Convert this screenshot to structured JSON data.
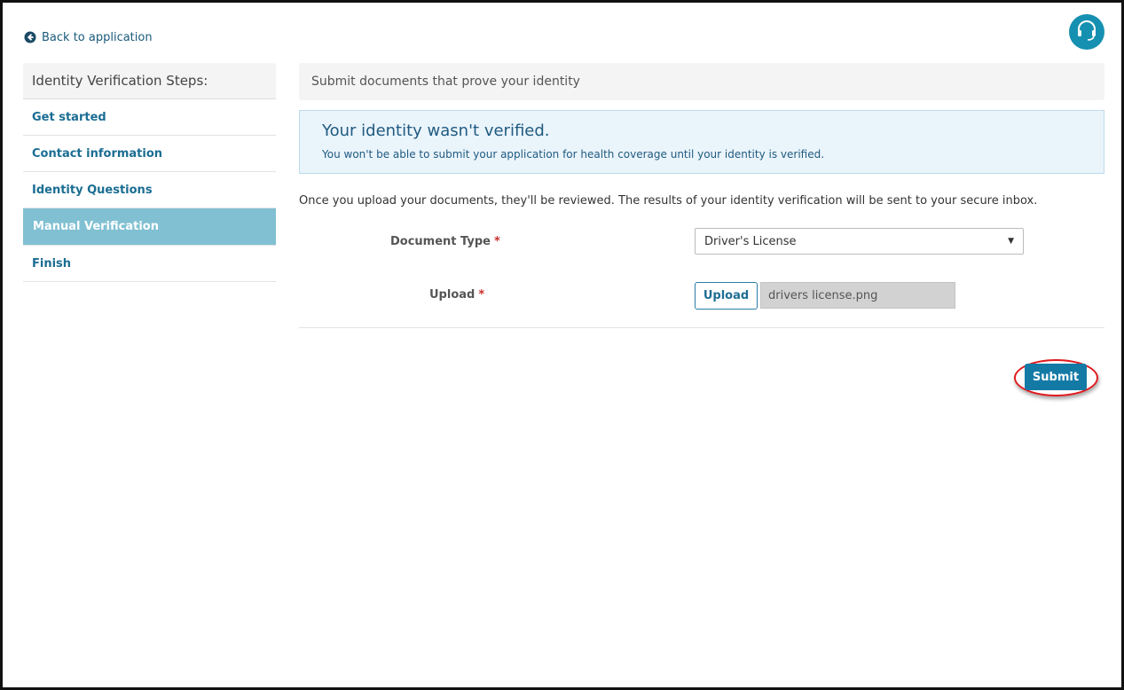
{
  "nav": {
    "back_label": "Back to application"
  },
  "sidebar": {
    "title": "Identity Verification Steps:",
    "items": [
      {
        "label": "Get started"
      },
      {
        "label": "Contact information"
      },
      {
        "label": "Identity Questions"
      },
      {
        "label": "Manual Verification"
      },
      {
        "label": "Finish"
      }
    ],
    "active_index": 3
  },
  "main": {
    "title": "Submit documents that prove your identity",
    "alert": {
      "title": "Your identity wasn't verified.",
      "body": "You won't be able to submit your application for health coverage until your identity is verified."
    },
    "intro": "Once you upload your documents, they'll be reviewed. The results of your identity verification will be sent to your secure inbox.",
    "form": {
      "document_type_label": "Document Type",
      "document_type_value": "Driver's License",
      "upload_label": "Upload",
      "upload_button_label": "Upload",
      "file_name": "drivers license.png",
      "required_marker": "*"
    },
    "submit_label": "Submit"
  },
  "colors": {
    "accent": "#137aa6",
    "sidebar_active": "#80c0d2",
    "alert_bg": "#eaf4fb",
    "annotation_ring": "#e0191d"
  },
  "icons": {
    "back": "arrow-circle-left-icon",
    "help": "headset-icon",
    "dropdown": "caret-down-icon"
  }
}
